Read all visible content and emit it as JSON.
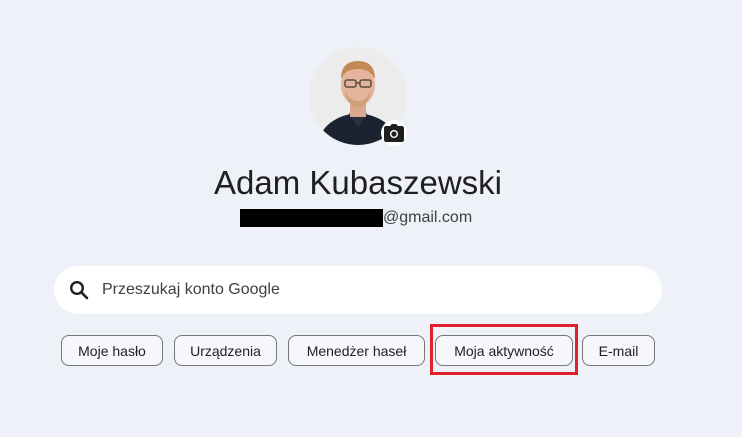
{
  "profile": {
    "name": "Adam Kubaszewski",
    "email_suffix": "@gmail.com",
    "email_redacted": true,
    "camera_icon": "camera-icon"
  },
  "search": {
    "placeholder": "Przeszukaj konto Google",
    "icon": "search-icon"
  },
  "chips": [
    {
      "label": "Moje hasło"
    },
    {
      "label": "Urządzenia"
    },
    {
      "label": "Menedżer haseł"
    },
    {
      "label": "Moja aktywność",
      "highlighted": true
    },
    {
      "label": "E-mail"
    }
  ],
  "colors": {
    "background": "#eef1f7",
    "highlight": "#e0202a",
    "chip_border": "#747775"
  }
}
